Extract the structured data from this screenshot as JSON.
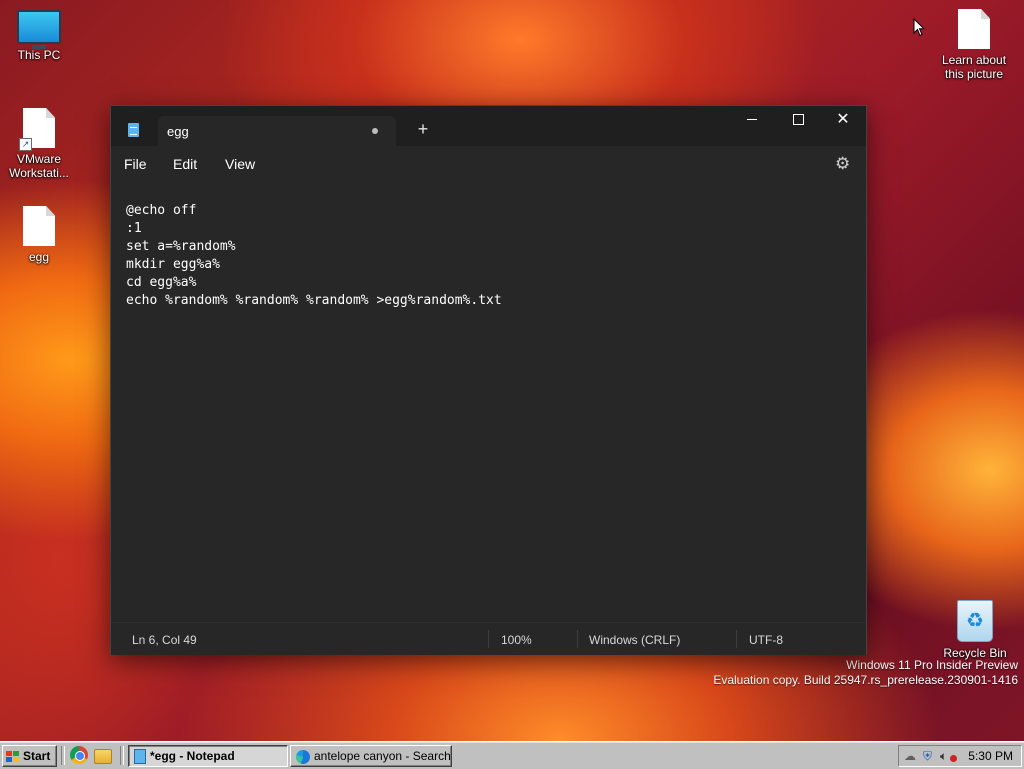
{
  "desktop": {
    "icons": {
      "this_pc": "This PC",
      "vmware": "VMware Workstati...",
      "egg": "egg",
      "learn": "Learn about this picture",
      "recycle_bin": "Recycle Bin"
    },
    "watermark": {
      "line1": "Windows 11 Pro Insider Preview",
      "line2": "Evaluation copy. Build 25947.rs_prerelease.230901-1416"
    }
  },
  "notepad": {
    "tab_title": "egg",
    "new_tab": "+",
    "controls": {
      "close": "✕"
    },
    "menu": {
      "file": "File",
      "edit": "Edit",
      "view": "View"
    },
    "settings_icon": "gear-icon",
    "lines": [
      "@echo off",
      ":1",
      "set a=%random%",
      "mkdir egg%a%",
      "cd egg%a%",
      "echo %random% %random% %random% >egg%random%.txt"
    ],
    "status": {
      "position": "Ln 6, Col 49",
      "zoom": "100%",
      "line_ending": "Windows (CRLF)",
      "encoding": "UTF-8"
    }
  },
  "taskbar": {
    "start": "Start",
    "tasks": [
      {
        "label": "*egg - Notepad",
        "active": true
      },
      {
        "label": "antelope canyon - Search...",
        "active": false
      }
    ],
    "clock": "5:30 PM"
  },
  "colors": {
    "window_bg": "#272727",
    "titlebar_bg": "#1f1f1f",
    "taskbar_bg": "#c0c0c0",
    "accent_blue": "#5fb4ee"
  }
}
